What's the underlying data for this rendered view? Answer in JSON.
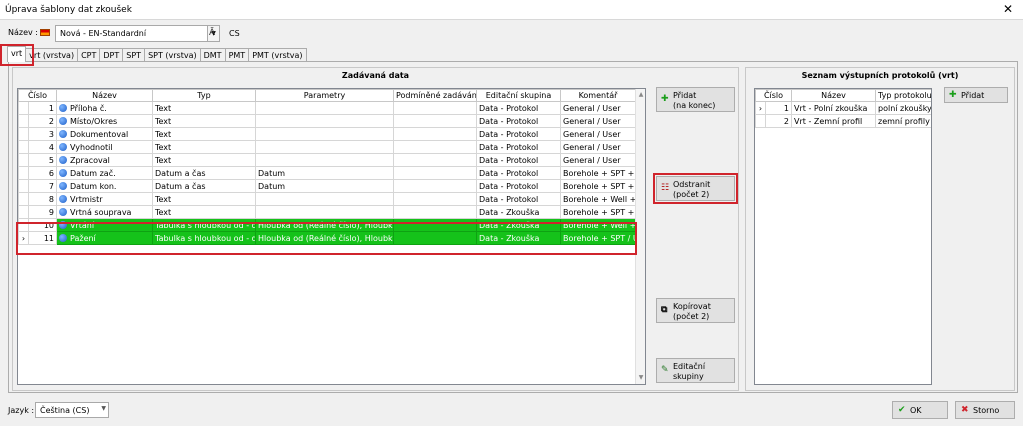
{
  "window": {
    "title": "Úprava šablony dat zkoušek",
    "close": "✕"
  },
  "name_field": {
    "label": "Název :",
    "value": "Nová - EN-Standardní",
    "lang_code": "CS",
    "translate_icon": "Ā"
  },
  "tabs": [
    {
      "label": "vrt",
      "active": true
    },
    {
      "label": "vrt (vrstva)"
    },
    {
      "label": "CPT"
    },
    {
      "label": "DPT"
    },
    {
      "label": "SPT"
    },
    {
      "label": "SPT (vrstva)"
    },
    {
      "label": "DMT"
    },
    {
      "label": "PMT"
    },
    {
      "label": "PMT (vrstva)"
    }
  ],
  "input_data": {
    "title": "Zadávaná data",
    "columns": [
      "Číslo",
      "Název",
      "Typ",
      "Parametry",
      "Podmíněné zadávání",
      "Editační skupina",
      "Komentář"
    ],
    "rows": [
      {
        "num": "1",
        "name": "Příloha č.",
        "type": "Text",
        "params": "",
        "cond": "",
        "group": "Data - Protokol",
        "comment": "General / User"
      },
      {
        "num": "2",
        "name": "Místo/Okres",
        "type": "Text",
        "params": "",
        "cond": "",
        "group": "Data - Protokol",
        "comment": "General / User"
      },
      {
        "num": "3",
        "name": "Dokumentoval",
        "type": "Text",
        "params": "",
        "cond": "",
        "group": "Data - Protokol",
        "comment": "General / User"
      },
      {
        "num": "4",
        "name": "Vyhodnotil",
        "type": "Text",
        "params": "",
        "cond": "",
        "group": "Data - Protokol",
        "comment": "General / User"
      },
      {
        "num": "5",
        "name": "Zpracoval",
        "type": "Text",
        "params": "",
        "cond": "",
        "group": "Data - Protokol",
        "comment": "General / User"
      },
      {
        "num": "6",
        "name": "Datum zač.",
        "type": "Datum a čas",
        "params": "Datum",
        "cond": "",
        "group": "Data - Protokol",
        "comment": "Borehole + SPT + PMT"
      },
      {
        "num": "7",
        "name": "Datum kon.",
        "type": "Datum a čas",
        "params": "Datum",
        "cond": "",
        "group": "Data - Protokol",
        "comment": "Borehole + SPT + PMT"
      },
      {
        "num": "8",
        "name": "Vrtmistr",
        "type": "Text",
        "params": "",
        "cond": "",
        "group": "Data - Protokol",
        "comment": "Borehole + Well + SPT"
      },
      {
        "num": "9",
        "name": "Vrtná souprava",
        "type": "Text",
        "params": "",
        "cond": "",
        "group": "Data - Zkouška",
        "comment": "Borehole + SPT + PMT"
      },
      {
        "num": "10",
        "name": "Vrtání",
        "type": "Tabulka s hloubkou od - do",
        "params": "Hloubka od (Reálné číslo), Hloubka do",
        "cond": "",
        "group": "Data - Zkouška",
        "comment": "Borehole + Well + SPT",
        "selected": true
      },
      {
        "num": "11",
        "name": "Pažení",
        "type": "Tabulka s hloubkou od - do",
        "params": "Hloubka od (Reálné číslo), Hloubka do",
        "cond": "",
        "group": "Data - Zkouška",
        "comment": "Borehole + SPT / User",
        "selected": true,
        "current": true
      }
    ]
  },
  "buttons": {
    "add": "Přidat\n(na konec)",
    "add_l1": "Přidat",
    "add_l2": "(na konec)",
    "remove_l1": "Odstranit",
    "remove_l2": "(počet 2)",
    "copy_l1": "Kopírovat",
    "copy_l2": "(počet 2)",
    "edit_l1": "Editační",
    "edit_l2": "skupiny",
    "add_protocol": "Přidat",
    "ok": "OK",
    "cancel": "Storno"
  },
  "protocols": {
    "title": "Seznam výstupních protokolů (vrt)",
    "columns": [
      "Číslo",
      "Název",
      "Typ protokolu"
    ],
    "rows": [
      {
        "num": "1",
        "name": "Vrt - Polní zkouška",
        "type": "polní zkoušky",
        "current": true
      },
      {
        "num": "2",
        "name": "Vrt - Zemní profil",
        "type": "zemní profily"
      }
    ]
  },
  "language": {
    "label": "Jazyk :",
    "value": "Čeština (CS)"
  },
  "colors": {
    "selected_row": "#15c21a",
    "highlight_box": "#d0242c"
  }
}
